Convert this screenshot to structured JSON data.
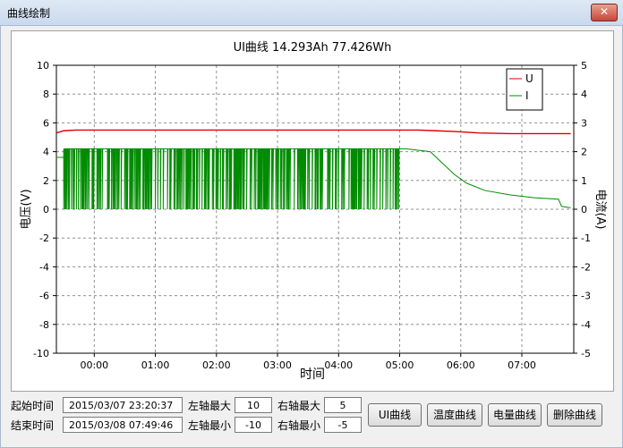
{
  "window": {
    "title": "曲线绘制",
    "close_glyph": "✕"
  },
  "chart_data": {
    "type": "line",
    "title": "UI曲线 14.293Ah 77.426Wh",
    "xlabel": "时间",
    "ylabel_left": "电压(V)",
    "ylabel_right": "电流(A)",
    "ylim_left": [
      -10,
      10
    ],
    "ylim_right": [
      -5,
      5
    ],
    "left_ticks": [
      "10",
      "8",
      "6",
      "4",
      "2",
      "0",
      "-2",
      "-4",
      "-6",
      "-8",
      "-10"
    ],
    "right_ticks": [
      "5",
      "4",
      "3",
      "2",
      "1",
      "0",
      "-1",
      "-2",
      "-3",
      "-4",
      "-5"
    ],
    "x_ticks": [
      "00:00",
      "01:00",
      "02:00",
      "03:00",
      "04:00",
      "05:00",
      "06:00",
      "07:00"
    ],
    "grid": true,
    "legend_position": "top-right",
    "series": [
      {
        "name": "U",
        "axis": "left",
        "color": "#e00000",
        "x_hours": [
          -0.62,
          -0.5,
          -0.3,
          0.0,
          1.0,
          2.0,
          3.0,
          4.0,
          5.0,
          5.3,
          5.6,
          5.9,
          6.3,
          6.8,
          7.2,
          7.8
        ],
        "values": [
          5.3,
          5.45,
          5.5,
          5.5,
          5.5,
          5.5,
          5.5,
          5.5,
          5.5,
          5.5,
          5.45,
          5.4,
          5.3,
          5.25,
          5.25,
          5.25
        ]
      },
      {
        "name": "I",
        "axis": "right",
        "color": "#008c00",
        "x_hours": [
          -0.62,
          -0.5,
          -0.45,
          5.0,
          5.1,
          5.3,
          5.5,
          5.7,
          5.9,
          6.1,
          6.4,
          6.8,
          7.2,
          7.6,
          7.65,
          7.8
        ],
        "values": [
          1.8,
          1.8,
          2.1,
          2.1,
          2.1,
          2.05,
          2.0,
          1.6,
          1.2,
          0.9,
          0.65,
          0.5,
          0.4,
          0.35,
          0.1,
          0.05
        ],
        "pulsed_until_hour": 5.0,
        "pulse_low": 0.0,
        "pulse_high": 2.1
      }
    ]
  },
  "form": {
    "start_label": "起始时间",
    "start_value": "2015/03/07 23:20:37",
    "end_label": "结束时间",
    "end_value": "2015/03/08 07:49:46",
    "left_max_label": "左轴最大",
    "left_max_value": "10",
    "left_min_label": "左轴最小",
    "left_min_value": "-10",
    "right_max_label": "右轴最大",
    "right_max_value": "5",
    "right_min_label": "右轴最小",
    "right_min_value": "-5"
  },
  "buttons": {
    "ui_curve": "UI曲线",
    "temp_curve": "温度曲线",
    "capacity_curve": "电量曲线",
    "delete_curve": "删除曲线"
  }
}
